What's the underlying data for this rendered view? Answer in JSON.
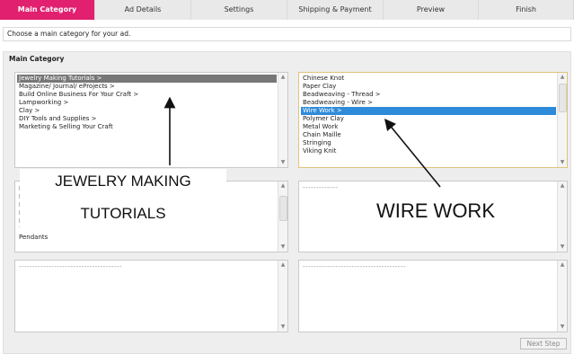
{
  "tabs": [
    {
      "label": "Main Category",
      "active": true
    },
    {
      "label": "Ad Details",
      "active": false
    },
    {
      "label": "Settings",
      "active": false
    },
    {
      "label": "Shipping & Payment",
      "active": false
    },
    {
      "label": "Preview",
      "active": false
    },
    {
      "label": "Finish",
      "active": false
    }
  ],
  "instruction": "Choose a main category for your ad.",
  "panel_title": "Main Category",
  "lists": {
    "main_categories": [
      "Jewelry Making Tutorials >",
      "Magazine/ Journal/ eProjects >",
      "Build Online Business For Your Craft >",
      "Lampworking >",
      "Clay >",
      "DIY Tools and Supplies >",
      "Marketing & Selling Your Craft"
    ],
    "main_selected": "Jewelry Making Tutorials >",
    "subcategories": [
      "Chinese Knot",
      "Paper Clay",
      "Beadweaving - Thread >",
      "Beadweaving - Wire >",
      "Wire Work >",
      "Polymer Clay",
      "Metal Work",
      "Chain Maille",
      "Stringing",
      "Viking Knit"
    ],
    "sub_selected": "Wire Work >",
    "third_left_visible": "Pendants",
    "third_right_dashes": "-------------",
    "fourth_left_dashes": "--------------------------------------",
    "fourth_right_dashes": "--------------------------------------"
  },
  "annotations": {
    "left_line1": "JEWELRY MAKING",
    "left_line2": "TUTORIALS",
    "right": "WIRE WORK"
  },
  "next_step": "Next Step",
  "colors": {
    "active_tab": "#e1206f",
    "selected_grey": "#777777",
    "selected_blue": "#2e8bd9",
    "highlight_border": "#e0c27a"
  }
}
